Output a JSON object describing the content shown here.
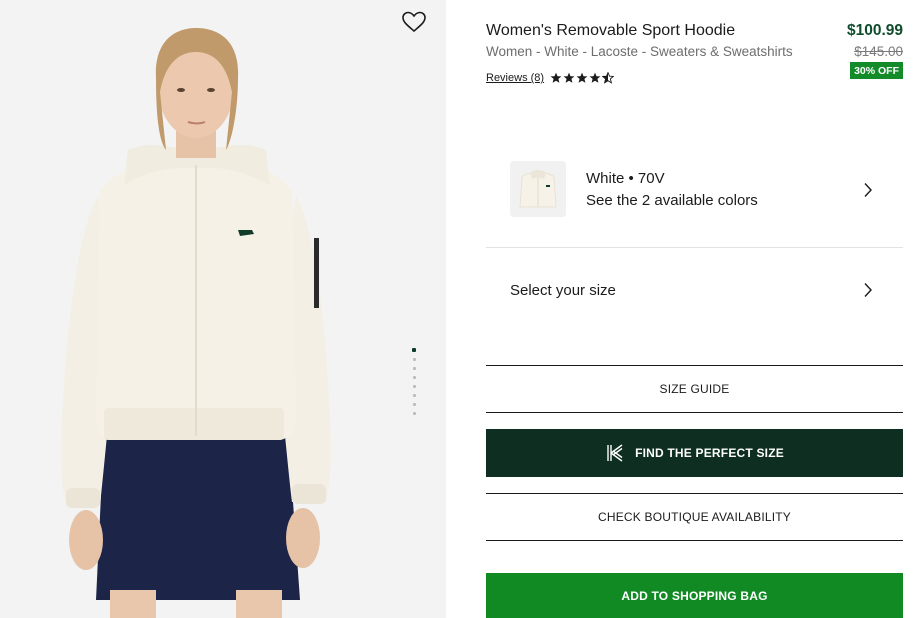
{
  "product": {
    "title": "Women's Removable Sport Hoodie",
    "breadcrumb": "Women - White - Lacoste - Sweaters & Sweatshirts",
    "price": "$100.99",
    "original_price": "$145.00",
    "discount_badge": "30% OFF",
    "reviews_link": "Reviews (8)",
    "rating": 4.5,
    "rating_max": 5
  },
  "color_selector": {
    "name": "White • 70V",
    "sub": "See the 2 available colors"
  },
  "size_selector": {
    "label": "Select your size"
  },
  "buttons": {
    "size_guide": "SIZE GUIDE",
    "find_size": "FIND THE PERFECT SIZE",
    "boutique": "CHECK BOUTIQUE AVAILABILITY",
    "add_to_bag": "ADD TO SHOPPING BAG"
  },
  "gallery": {
    "image_count": 8,
    "active_index": 0
  },
  "colors": {
    "brand_dark": "#0d2e20",
    "cta_green": "#118a24",
    "price_green": "#0f4d2c",
    "badge_green": "#138b29"
  },
  "icons": {
    "wishlist": "heart-outline-icon",
    "chevron": "chevron-right-icon",
    "star": "star-icon",
    "fit": "fit-finder-k-icon"
  }
}
